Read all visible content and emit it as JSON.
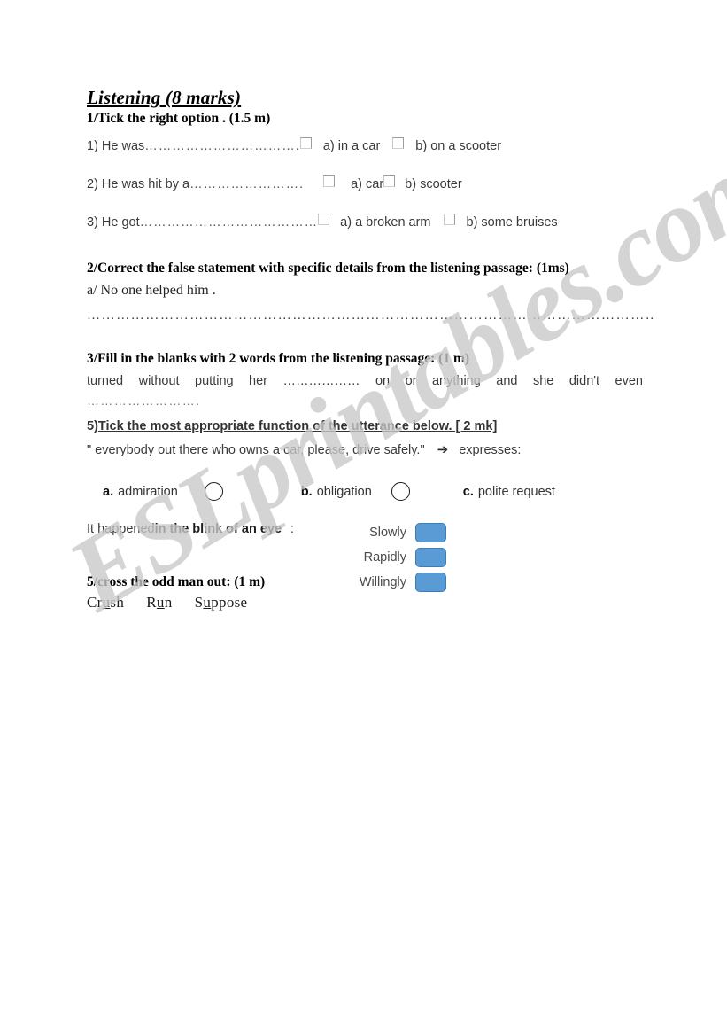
{
  "watermark": {
    "text": "ESLprintables.com"
  },
  "worksheet": {
    "title": "Listening (8 marks)",
    "section1": {
      "heading": "1/Tick the right option . (1.5 m)",
      "items": [
        {
          "stem": "1) He was ",
          "dots": "……………………………. ",
          "option_a": "a) in a car",
          "option_b": "b) on a scooter"
        },
        {
          "stem": "2) He was hit by a ",
          "dots": "…………………….",
          "option_a": "a) car",
          "option_b": "b) scooter"
        },
        {
          "stem": "3) He got",
          "dots": "…………………………………",
          "option_a": "a) a broken arm",
          "option_b": "b) some bruises"
        }
      ]
    },
    "section2": {
      "heading": "2/Correct the false statement with specific details from the listening passage: (1ms)",
      "statement": "a/  No one helped him .",
      "answer_line": "…………………………………………………………………………………………………………………."
    },
    "section3": {
      "heading": "3/Fill in the blanks with 2 words from the listening passage: (1 m)",
      "passage": "turned without putting her ……………… on or anything and she didn't even",
      "answer_line": "……………………."
    },
    "section5a": {
      "number": "5)",
      "heading": "Tick the most appropriate function of the utterance below. [ 2 mk]",
      "utterance": "\" everybody out there who owns a car, please, drive safely.\"",
      "arrow": "➔",
      "expresses": "expresses:",
      "options": [
        {
          "letter": "a.",
          "label": "admiration"
        },
        {
          "letter": "b.",
          "label": "obligation"
        },
        {
          "letter": "c.",
          "label": "polite request"
        }
      ]
    },
    "idiom": {
      "prefix": "It happened ",
      "phrase": "in the blink of an eye",
      "colon": ": ",
      "choices": [
        "Slowly",
        "Rapidly",
        "Willingly"
      ],
      "button_color": "#5b9bd5"
    },
    "section5b": {
      "heading": "5/cross the odd man out: (1 m)",
      "words": [
        {
          "pre": "Cr",
          "mid": "u",
          "post": "sh"
        },
        {
          "pre": "R",
          "mid": "u",
          "post": "n"
        },
        {
          "pre": "S",
          "mid": "u",
          "post": "ppose"
        }
      ]
    }
  }
}
